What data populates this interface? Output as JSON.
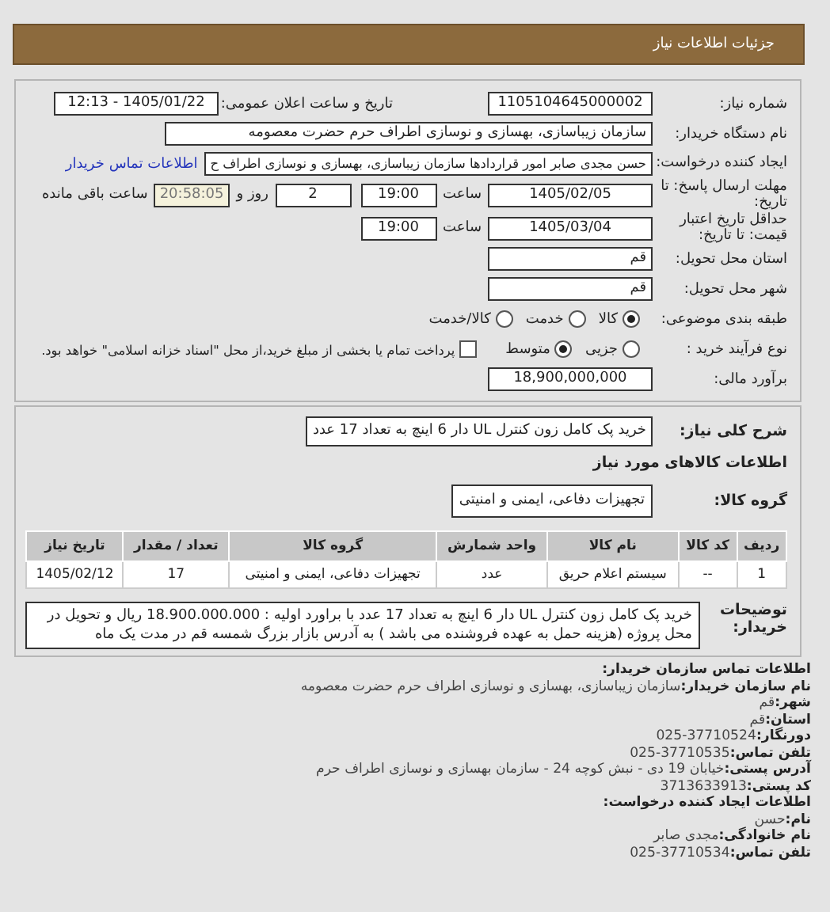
{
  "header": {
    "title": "جزئیات اطلاعات نیاز"
  },
  "need_number": {
    "label": "شماره نیاز:",
    "value": "1105104645000002"
  },
  "announce": {
    "label": "تاریخ و ساعت اعلان عمومی:",
    "value": "1405/01/22 - 12:13"
  },
  "buyer_org": {
    "label": "نام دستگاه خریدار:",
    "value": "سازمان زیباسازی، بهسازی و نوسازی اطراف حرم حضرت معصومه"
  },
  "creator": {
    "label": "ایجاد کننده درخواست:",
    "value": "حسن مجدی صابر امور قراردادها سازمان زیباسازی، بهسازی و نوسازی اطراف ح",
    "link": "اطلاعات تماس خریدار"
  },
  "deadline": {
    "label": "مهلت ارسال پاسخ: تا تاریخ:",
    "date": "1405/02/05",
    "time_label": "ساعت",
    "time": "19:00",
    "days": "2",
    "days_label": "روز و",
    "remaining": "20:58:05",
    "remaining_label": "ساعت باقی مانده"
  },
  "validity": {
    "label": "حداقل تاریخ اعتبار قیمت: تا تاریخ:",
    "date": "1405/03/04",
    "time_label": "ساعت",
    "time": "19:00"
  },
  "province": {
    "label": "استان محل تحویل:",
    "value": "قم"
  },
  "city": {
    "label": "شهر محل تحویل:",
    "value": "قم"
  },
  "category": {
    "label": "طبقه بندی موضوعی:",
    "options": [
      {
        "label": "کالا",
        "selected": true
      },
      {
        "label": "خدمت",
        "selected": false
      },
      {
        "label": "کالا/خدمت",
        "selected": false
      }
    ]
  },
  "purchase_type": {
    "label": "نوع فرآیند خرید :",
    "options": [
      {
        "label": "جزیی",
        "selected": false
      },
      {
        "label": "متوسط",
        "selected": true
      }
    ],
    "treasury": {
      "label": "پرداخت تمام یا بخشی از مبلغ خرید،از محل \"اسناد خزانه اسلامی\" خواهد بود.",
      "checked": false
    }
  },
  "estimate": {
    "label": "برآورد مالی:",
    "value": "18,900,000,000"
  },
  "summary": {
    "label": "شرح کلی نیاز:",
    "value": "خرید پک کامل زون کنترل UL دار 6 اینچ به تعداد 17 عدد"
  },
  "goods_heading": "اطلاعات کالاهای مورد نیاز",
  "goods_group": {
    "label": "گروه کالا:",
    "value": "تجهیزات دفاعی، ایمنی و امنیتی"
  },
  "table": {
    "columns": [
      "ردیف",
      "کد کالا",
      "نام کالا",
      "واحد شمارش",
      "گروه کالا",
      "تعداد / مقدار",
      "تاریخ نیاز"
    ],
    "rows": [
      [
        "1",
        "--",
        "سیستم اعلام حریق",
        "عدد",
        "تجهیزات دفاعی، ایمنی و امنیتی",
        "17",
        "1405/02/12"
      ]
    ]
  },
  "buyer_notes": {
    "label": "توضیحات خریدار:",
    "value": "خرید پک کامل زون کنترل UL دار 6 اینچ به تعداد 17 عدد با براورد اولیه : 18.900.000.000 ریال و تحویل در محل پروژه (هزینه حمل به عهده فروشنده می باشد ) به آدرس بازار بزرگ شمسه قم در مدت یک ماه"
  },
  "contact": [
    {
      "kind": "heading",
      "label": "اطلاعات تماس سازمان خریدار:"
    },
    {
      "kind": "field",
      "label": "نام سازمان خریدار:",
      "value": "سازمان زیباسازی، بهسازی و نوسازی اطراف حرم حضرت معصومه"
    },
    {
      "kind": "field",
      "label": "شهر:",
      "value": "قم"
    },
    {
      "kind": "field",
      "label": "استان:",
      "value": "قم"
    },
    {
      "kind": "field",
      "label": "دورنگار:",
      "value": "37710524-025"
    },
    {
      "kind": "field",
      "label": "تلفن تماس:",
      "value": "37710535-025"
    },
    {
      "kind": "field",
      "label": "آدرس پستی:",
      "value": "خیابان 19 دی - نبش کوچه 24 - سازمان بهسازی و نوسازی اطراف حرم"
    },
    {
      "kind": "field",
      "label": "کد پستی:",
      "value": "3713633913"
    },
    {
      "kind": "heading",
      "label": "اطلاعات ایجاد کننده درخواست:"
    },
    {
      "kind": "field",
      "label": "نام:",
      "value": "حسن"
    },
    {
      "kind": "field",
      "label": "نام خانوادگی:",
      "value": "مجدی صابر"
    },
    {
      "kind": "field",
      "label": "تلفن تماس:",
      "value": "37710534-025"
    }
  ]
}
